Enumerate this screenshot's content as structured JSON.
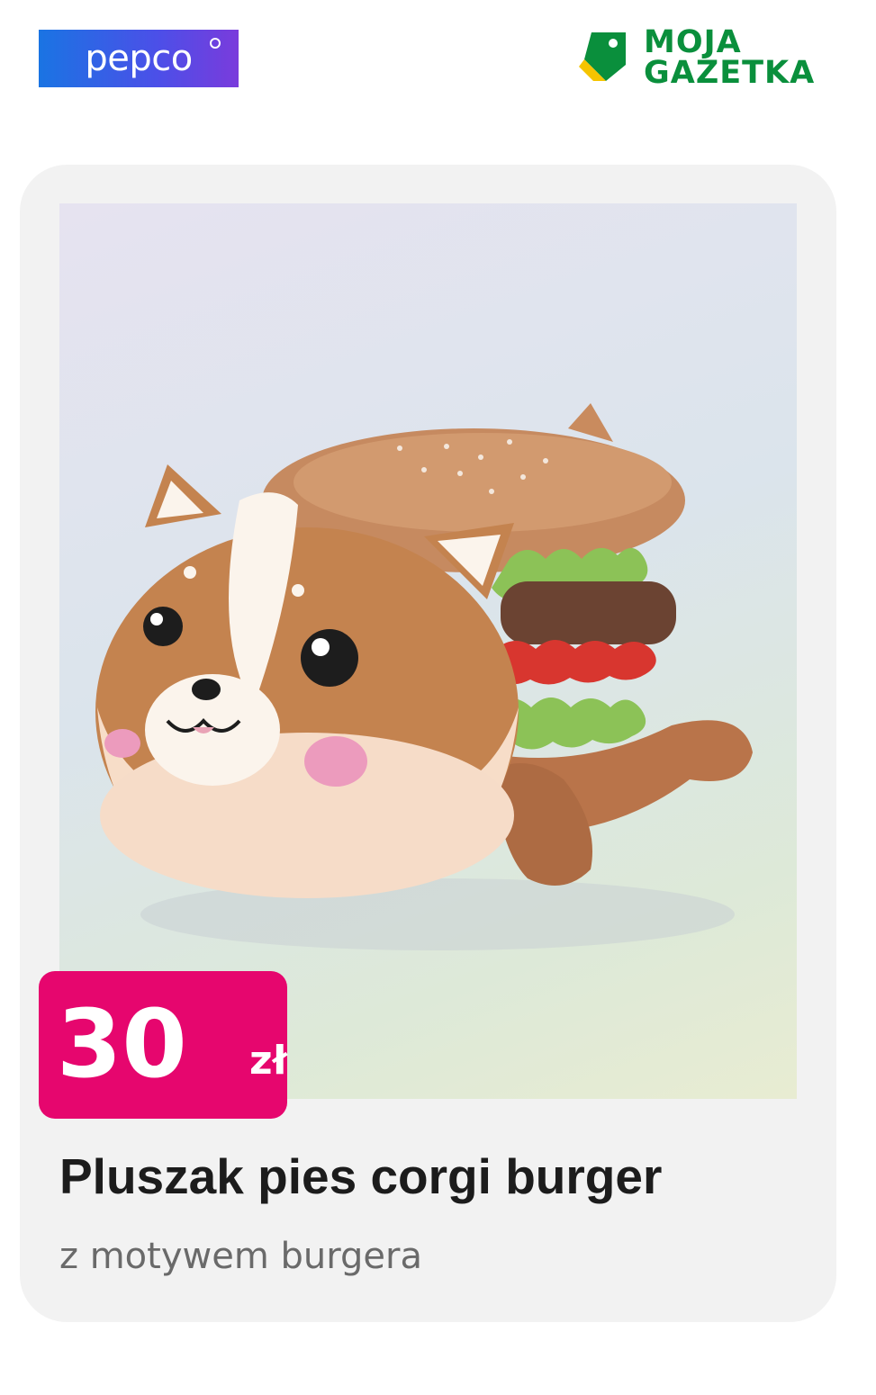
{
  "header": {
    "brand_logo": "pepco",
    "partner_logo_line1": "MOJA",
    "partner_logo_line2": "GAZETKA"
  },
  "product": {
    "image_icon": "plush-corgi-burger-photo",
    "price_amount": "30",
    "price_currency": "zł",
    "title": "Pluszak pies corgi burger",
    "subtitle": "z motywem burgera"
  },
  "colors": {
    "pepco_brand": "#3f5fe6",
    "moja_gazetka_green": "#0a8f3c",
    "price_badge": "#e6066e",
    "card_background": "#f2f2f2"
  }
}
